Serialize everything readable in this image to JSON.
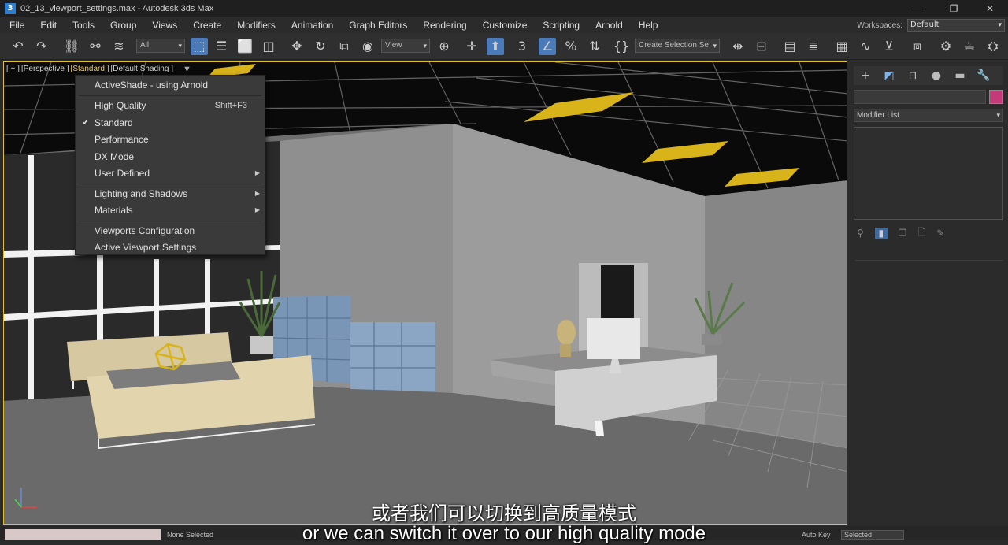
{
  "window": {
    "app_icon_letter": "3",
    "title": "02_13_viewport_settings.max - Autodesk 3ds Max",
    "controls": [
      "—",
      "❐",
      "✕"
    ]
  },
  "menubar": {
    "items": [
      "File",
      "Edit",
      "Tools",
      "Group",
      "Views",
      "Create",
      "Modifiers",
      "Animation",
      "Graph Editors",
      "Rendering",
      "Customize",
      "Scripting",
      "Arnold",
      "Help"
    ],
    "workspace_label": "Workspaces:",
    "workspace_value": "Default"
  },
  "toolbar": {
    "filter_value": "All",
    "refcoord_value": "View",
    "selection_set_placeholder": "Create Selection Se"
  },
  "viewport": {
    "label_plus": "[ + ]",
    "label_view": "[Perspective ]",
    "label_shading_mode": "[Standard ]",
    "label_shading": "[Default Shading ]"
  },
  "context_menu": {
    "activeshade": "ActiveShade - using Arnold",
    "high_quality": "High Quality",
    "high_quality_shortcut": "Shift+F3",
    "standard": "Standard",
    "performance": "Performance",
    "dx_mode": "DX Mode",
    "user_defined": "User Defined",
    "lighting_shadows": "Lighting and Shadows",
    "materials": "Materials",
    "viewports_configuration": "Viewports Configuration",
    "active_viewport_settings": "Active Viewport Settings"
  },
  "command_panel": {
    "modifier_list": "Modifier List",
    "swatch_color": "#c53a78"
  },
  "statusbar": {
    "selection": "None Selected",
    "autokey": "Auto Key",
    "selected": "Selected"
  },
  "subtitles": {
    "chinese": "或者我们可以切换到高质量模式",
    "english": "or we can switch it over to our high quality mode"
  }
}
